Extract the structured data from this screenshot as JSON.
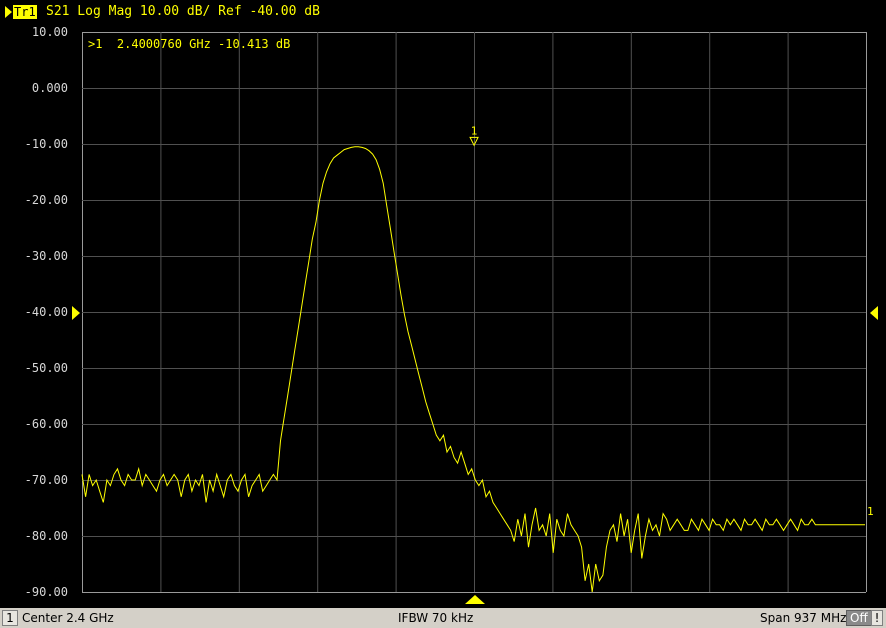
{
  "trace": {
    "badge": "Tr1",
    "title": "S21 Log Mag 10.00 dB/ Ref -40.00 dB"
  },
  "marker_readout": {
    "text": ">1  2.4000760 GHz -10.413 dB"
  },
  "marker": {
    "label": "1",
    "frequency_ghz": 2.400076,
    "value_db": -10.413
  },
  "trace_end_label": "1",
  "y_axis": {
    "ticks": [
      "10.00",
      "0.000",
      "-10.00",
      "-20.00",
      "-30.00",
      "-40.00",
      "-50.00",
      "-60.00",
      "-70.00",
      "-80.00",
      "-90.00"
    ],
    "ref_level_db": -40,
    "scale_db_per_div": 10
  },
  "footer": {
    "channel": "1",
    "center": "Center  2.4 GHz",
    "ifbw": "IFBW 70 kHz",
    "span": "Span 937 MHz",
    "off": "Off",
    "bang": "!"
  },
  "colors": {
    "trace": "#ffff00",
    "grid": "#505050",
    "background": "#000000",
    "footer_bg": "#d4d0c8"
  },
  "chart_data": {
    "type": "line",
    "x_range_ghz": [
      1.9315,
      2.8685
    ],
    "ylim": [
      -90,
      10
    ],
    "grid": true,
    "series": [
      {
        "x_ghz": [
          1.9315,
          1.9358,
          1.94,
          1.9442,
          1.9485,
          1.9527,
          1.9569,
          1.9612,
          1.9654,
          1.9697,
          1.9739,
          1.9781,
          1.9824,
          1.9866,
          1.9908,
          1.9951,
          1.9993,
          2.0035,
          2.0078,
          2.012,
          2.0162,
          2.0205,
          2.0247,
          2.0289,
          2.0332,
          2.0374,
          2.0416,
          2.0459,
          2.0501,
          2.0544,
          2.0586,
          2.0628,
          2.0671,
          2.0713,
          2.0755,
          2.0798,
          2.084,
          2.0882,
          2.0925,
          2.0967,
          2.1009,
          2.1052,
          2.1094,
          2.1136,
          2.1179,
          2.1221,
          2.1263,
          2.1306,
          2.1348,
          2.1391,
          2.1433,
          2.1475,
          2.1518,
          2.156,
          2.1602,
          2.1645,
          2.1687,
          2.1729,
          2.1772,
          2.1814,
          2.1856,
          2.1899,
          2.1941,
          2.1983,
          2.2026,
          2.2068,
          2.211,
          2.2153,
          2.2195,
          2.2237,
          2.228,
          2.2322,
          2.2364,
          2.2407,
          2.2449,
          2.2491,
          2.2534,
          2.2576,
          2.2618,
          2.2661,
          2.2703,
          2.2745,
          2.2788,
          2.283,
          2.2872,
          2.2915,
          2.2957,
          2.3,
          2.3042,
          2.3084,
          2.3127,
          2.3169,
          2.3211,
          2.3254,
          2.3296,
          2.3338,
          2.3381,
          2.3423,
          2.3465,
          2.3508,
          2.355,
          2.3592,
          2.3635,
          2.3677,
          2.3719,
          2.3762,
          2.3804,
          2.3846,
          2.3889,
          2.3931,
          2.3973,
          2.4016,
          2.4058,
          2.41,
          2.4143,
          2.4185,
          2.4227,
          2.427,
          2.4312,
          2.4354,
          2.4397,
          2.4439,
          2.4481,
          2.4524,
          2.4566,
          2.4609,
          2.4651,
          2.4693,
          2.4736,
          2.4778,
          2.482,
          2.4863,
          2.4905,
          2.4947,
          2.499,
          2.5032,
          2.5074,
          2.5117,
          2.5159,
          2.5201,
          2.5244,
          2.5286,
          2.5328,
          2.5371,
          2.5413,
          2.5455,
          2.5498,
          2.554,
          2.5582,
          2.5625,
          2.5667,
          2.5709,
          2.5752,
          2.5794,
          2.5836,
          2.5879,
          2.5921,
          2.5963,
          2.6006,
          2.6048,
          2.609,
          2.6133,
          2.6175,
          2.6217,
          2.626,
          2.6302,
          2.6344,
          2.6387,
          2.6429,
          2.6471,
          2.6514,
          2.6556,
          2.6598,
          2.6641,
          2.6683,
          2.6725,
          2.6768,
          2.681,
          2.6852,
          2.6895,
          2.6937,
          2.6979,
          2.7022,
          2.7064,
          2.7106,
          2.7149,
          2.7191,
          2.7233,
          2.7276,
          2.7318,
          2.736,
          2.7403,
          2.7445,
          2.7487,
          2.753,
          2.7572,
          2.7614,
          2.7657,
          2.7699,
          2.7741,
          2.7784,
          2.7826,
          2.7868,
          2.7911,
          2.7953,
          2.7995,
          2.8038,
          2.808,
          2.8122,
          2.8165,
          2.8207,
          2.8249,
          2.8292,
          2.8334,
          2.8376,
          2.8419,
          2.8461,
          2.8503,
          2.8546,
          2.8588,
          2.863,
          2.8673
        ],
        "y_db": [
          -69,
          -73,
          -69,
          -71,
          -70,
          -72,
          -74,
          -70,
          -71,
          -69,
          -68,
          -70,
          -71,
          -69,
          -70,
          -70,
          -68,
          -71,
          -69,
          -70,
          -71,
          -72,
          -70,
          -69,
          -71,
          -70,
          -69,
          -70,
          -73,
          -70,
          -69,
          -72,
          -70,
          -71,
          -69,
          -74,
          -70,
          -72,
          -69,
          -71,
          -73,
          -70,
          -69,
          -71,
          -72,
          -70,
          -69,
          -73,
          -71,
          -70,
          -69,
          -72,
          -71,
          -70,
          -69,
          -70,
          -63,
          -59,
          -55,
          -51,
          -47,
          -43,
          -39,
          -35,
          -31,
          -27,
          -24,
          -20,
          -17,
          -15,
          -13.5,
          -12.5,
          -12,
          -11.5,
          -11,
          -10.8,
          -10.6,
          -10.5,
          -10.5,
          -10.6,
          -10.8,
          -11.2,
          -11.8,
          -12.8,
          -14.5,
          -17,
          -21,
          -25,
          -29,
          -33,
          -37,
          -40.5,
          -43.5,
          -46,
          -48.5,
          -51,
          -53.5,
          -56,
          -58,
          -60,
          -62,
          -63,
          -62,
          -65,
          -64,
          -66,
          -67,
          -65,
          -67,
          -69,
          -68,
          -70,
          -71,
          -70,
          -73,
          -72,
          -74,
          -75,
          -76,
          -77,
          -78,
          -79,
          -81,
          -77,
          -80,
          -76,
          -82,
          -78,
          -75,
          -79,
          -78,
          -80,
          -76,
          -83,
          -77,
          -79,
          -80,
          -76,
          -78,
          -79,
          -80,
          -82,
          -88,
          -85,
          -90,
          -85,
          -88,
          -87,
          -82,
          -79,
          -78,
          -81,
          -76,
          -80,
          -77,
          -83,
          -79,
          -76,
          -84,
          -80,
          -77,
          -79,
          -78,
          -80,
          -76,
          -77,
          -79,
          -78,
          -77,
          -78,
          -79,
          -79,
          -77,
          -78,
          -79,
          -77,
          -78,
          -79,
          -77,
          -78,
          -78,
          -79,
          -77,
          -78,
          -77,
          -78,
          -79,
          -77,
          -78,
          -78,
          -77,
          -78,
          -79,
          -77,
          -78,
          -78,
          -77,
          -78,
          -79,
          -78,
          -77,
          -78,
          -79,
          -77,
          -78,
          -78,
          -77,
          -78,
          -78,
          -78,
          -78,
          -78,
          -78,
          -78,
          -78,
          -78,
          -78,
          -78,
          -78,
          -78,
          -78,
          -78,
          -78,
          -78,
          -78,
          -78
        ]
      }
    ]
  }
}
